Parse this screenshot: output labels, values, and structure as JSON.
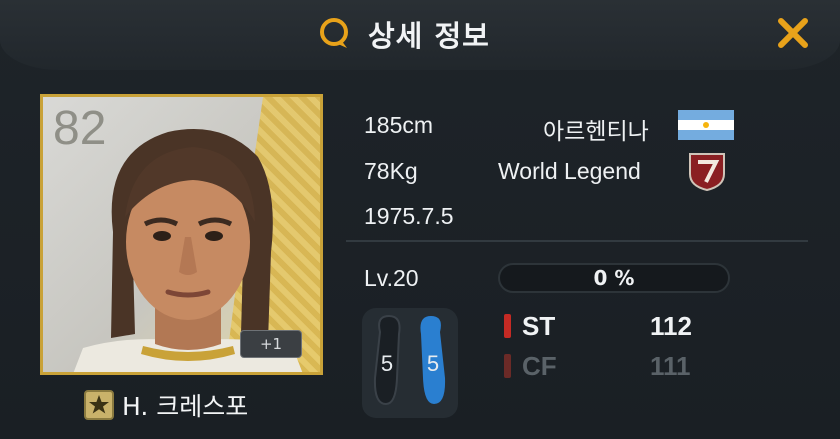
{
  "header": {
    "title": "상세 정보",
    "icon": "search-chat-icon",
    "close_icon": "close-icon",
    "accent": "#e8a21a"
  },
  "player": {
    "ovr": "82",
    "name": "H. 크레스포",
    "plus_level": "+1",
    "height": "185cm",
    "weight": "78Kg",
    "birthdate": "1975.7.5",
    "nationality": "아르헨티나",
    "season": "World Legend",
    "level": "Lv.20",
    "progress": "0 %",
    "progress_value": 0,
    "left_foot": "5",
    "right_foot": "5"
  },
  "positions": [
    {
      "pos": "ST",
      "value": "112",
      "active": true
    },
    {
      "pos": "CF",
      "value": "111",
      "active": false
    }
  ]
}
